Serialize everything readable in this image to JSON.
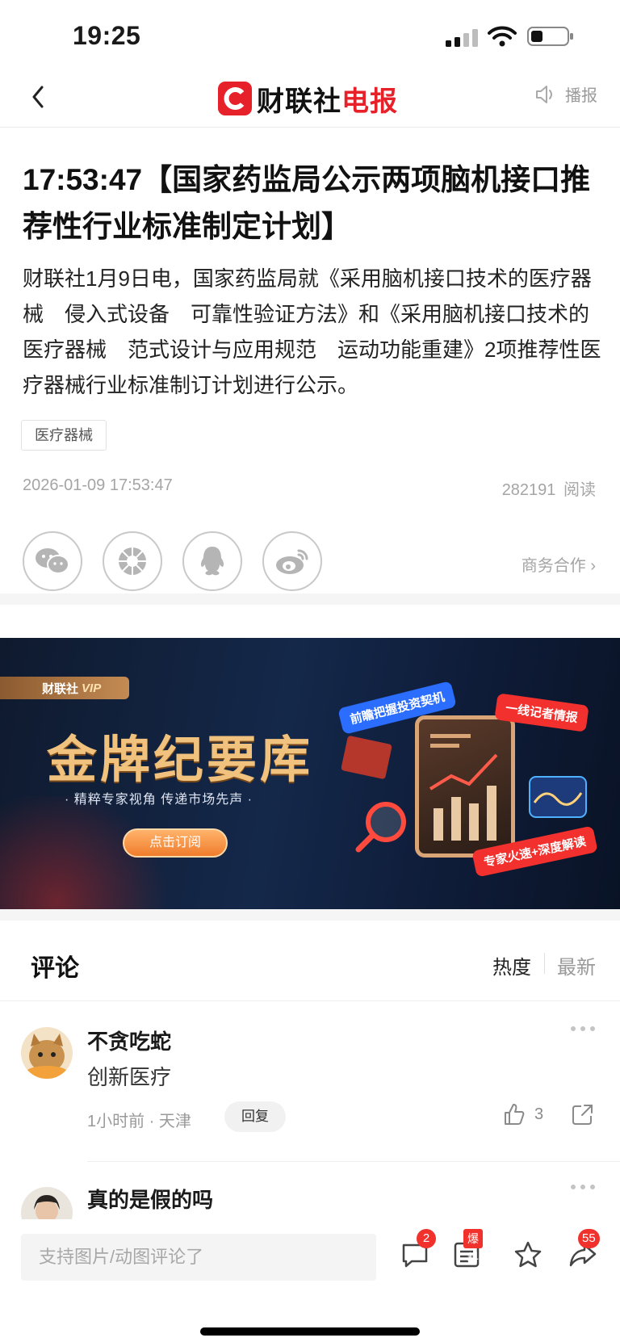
{
  "status_bar": {
    "time": "19:25"
  },
  "nav": {
    "logo_mark": "C",
    "logo_text_black": "财联社",
    "logo_text_red": "电报",
    "broadcast_label": "播报"
  },
  "article": {
    "headline": "17:53:47【国家药监局公示两项脑机接口推荐性行业标准制定计划】",
    "body": "财联社1月9日电，国家药监局就《采用脑机接口技术的医疗器械　侵入式设备　可靠性验证方法》和《采用脑机接口技术的医疗器械　范式设计与应用规范　运动功能重建》2项推荐性医疗器械行业标准制订计划进行公示。",
    "tag": "医疗器械",
    "date": "2026-01-09 17:53:47",
    "reads_count": "282191",
    "reads_label": "阅读",
    "share_icons": [
      "wechat-icon",
      "moments-icon",
      "qq-icon",
      "weibo-icon"
    ],
    "biz_label": "商务合作 ›"
  },
  "banner": {
    "vip_brand": "财联社",
    "vip_label": "VIP",
    "title": "金牌纪要库",
    "subtitle": "· 精粹专家视角 传递市场先声 ·",
    "button": "点击订阅",
    "bubble1": "前瞻把握投资契机",
    "bubble2": "一线记者情报",
    "bubble3": "专家火速+深度解读"
  },
  "comments": {
    "title": "评论",
    "sort_hot": "热度",
    "sort_new": "最新",
    "items": [
      {
        "user": "不贪吃蛇",
        "text": "创新医疗",
        "meta": "1小时前 · 天津",
        "reply": "回复",
        "likes": "3"
      },
      {
        "user": "真的是假的吗"
      }
    ]
  },
  "bottom_bar": {
    "input_placeholder": "支持图片/动图评论了",
    "comment_badge": "2",
    "tip_badge": "爆料",
    "share_badge": "55"
  },
  "colors": {
    "brand_red": "#e6212a",
    "banner_gold": "#f1c27d",
    "muted": "#a5a5a5"
  }
}
